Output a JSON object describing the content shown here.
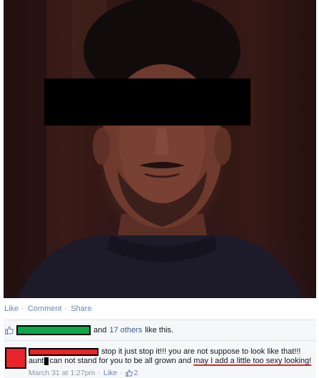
{
  "post_actions": {
    "like": "Like",
    "comment": "Comment",
    "share": "Share",
    "separator": "·"
  },
  "likes": {
    "and_text": "and",
    "others": "17 others",
    "suffix": "like this."
  },
  "comment": {
    "text_line1": "stop it just stop it!!! you are not suppose to look like that!!!",
    "text_line2_pre": "aunt",
    "text_line2_mid": "can not stand for you to be all grown and",
    "text_line2_underlined": "may I add a little too sexy looking!",
    "timestamp": "March 31 at 1:27pm",
    "like_label": "Like",
    "like_count": "2"
  },
  "colors": {
    "link": "#6d84b4",
    "redaction_green": "#0fa54a",
    "redaction_red": "#e8232a",
    "redaction_black": "#000000"
  }
}
